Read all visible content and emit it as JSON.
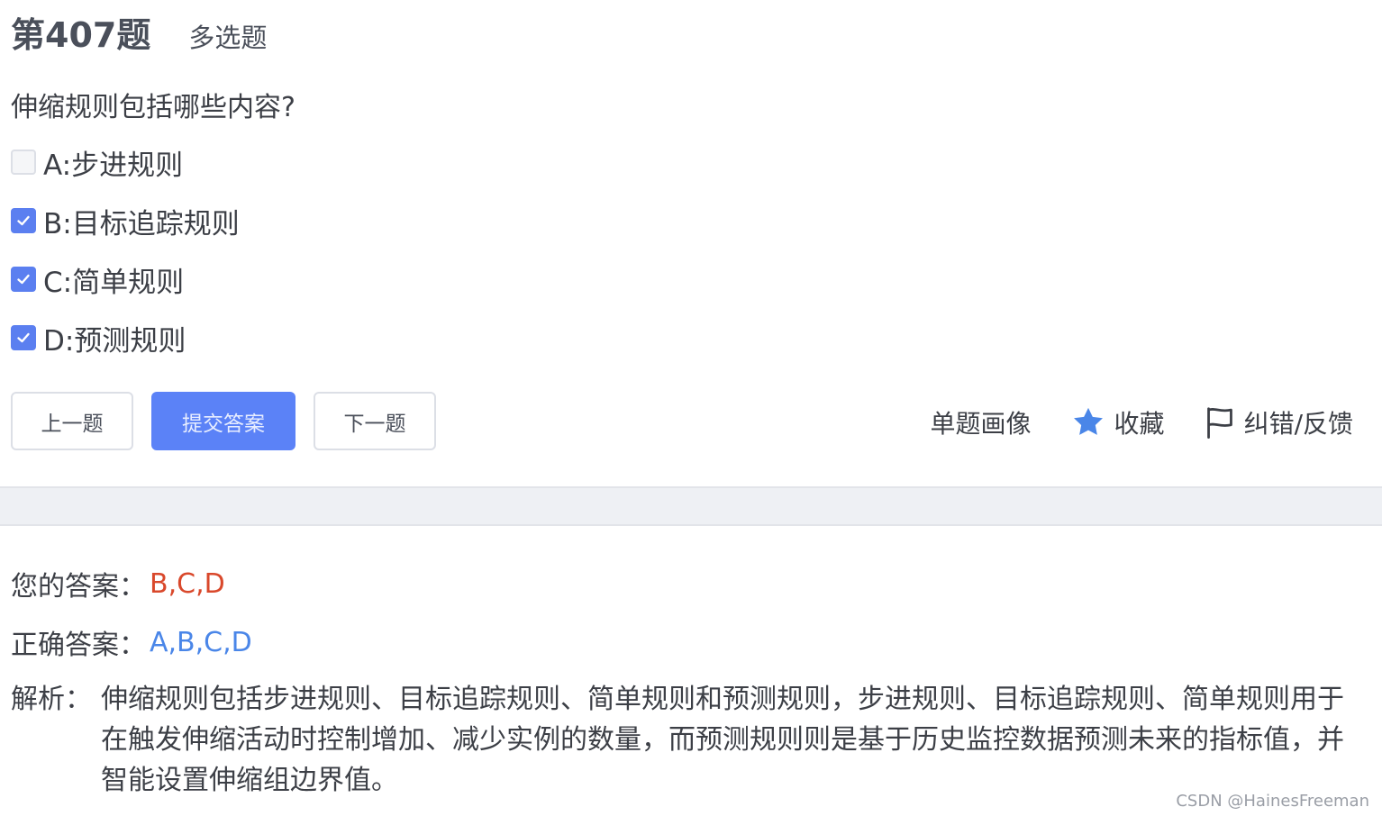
{
  "question": {
    "number": "第407题",
    "type": "多选题",
    "stem": "伸缩规则包括哪些内容?",
    "options": [
      {
        "label": "A:步进规则",
        "checked": false
      },
      {
        "label": "B:目标追踪规则",
        "checked": true
      },
      {
        "label": "C:简单规则",
        "checked": true
      },
      {
        "label": "D:预测规则",
        "checked": true
      }
    ]
  },
  "buttons": {
    "prev": "上一题",
    "submit": "提交答案",
    "next": "下一题"
  },
  "actions": {
    "portrait": "单题画像",
    "favorite": "收藏",
    "report": "纠错/反馈"
  },
  "result": {
    "your_answer_label": "您的答案：",
    "your_answer": "B,C,D",
    "correct_answer_label": "正确答案：",
    "correct_answer": "A,B,C,D",
    "analysis_label": "解析：",
    "analysis": "伸缩规则包括步进规则、目标追踪规则、简单规则和预测规则，步进规则、目标追踪规则、简单规则用于在触发伸缩活动时控制增加、减少实例的数量，而预测规则则是基于历史监控数据预测未来的指标值，并智能设置伸缩组边界值。"
  },
  "watermark": "CSDN @HainesFreeman",
  "colors": {
    "accent": "#5b82f7",
    "your_answer": "#d9482b",
    "correct_answer": "#4a86e8",
    "star": "#4a86e8"
  }
}
